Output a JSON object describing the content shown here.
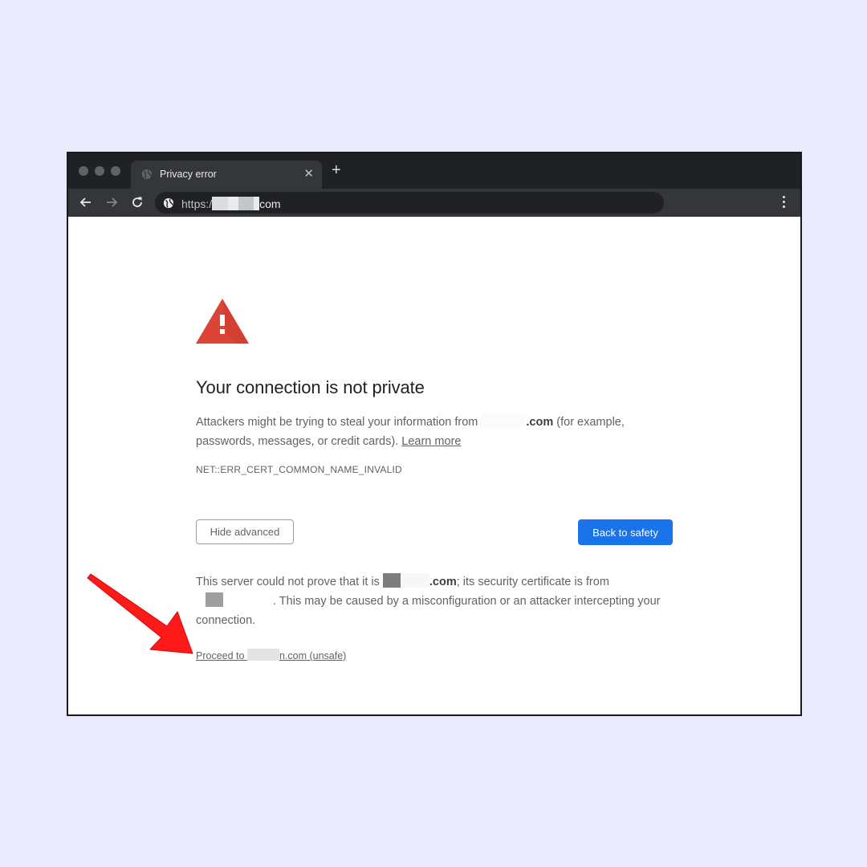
{
  "browser": {
    "tab": {
      "title": "Privacy error",
      "close_icon": "close-icon",
      "favicon": "globe-icon"
    },
    "new_tab_label": "+",
    "address_bar": {
      "scheme": "https:/",
      "host_suffix": "com",
      "redacted": true,
      "icon": "globe-icon"
    },
    "nav_icons": [
      "back-arrow-icon",
      "forward-arrow-icon",
      "reload-icon"
    ],
    "menu_icon": "kebab-menu-icon"
  },
  "page": {
    "warning_icon": "warning-triangle-icon",
    "heading": "Your connection is not private",
    "paragraph1": {
      "before": "Attackers might be trying to steal your information from ",
      "domain_suffix": ".com",
      "after": " (for example, passwords, messages, or credit cards). ",
      "learn_more": "Learn more"
    },
    "error_code": "NET::ERR_CERT_COMMON_NAME_INVALID",
    "buttons": {
      "hide_advanced": "Hide advanced",
      "back_to_safety": "Back to safety"
    },
    "paragraph3": {
      "before": "This server could not prove that it is ",
      "domain_suffix": ".com",
      "middle": "; its security certificate is from ",
      "after": ". This may be caused by a misconfiguration or an attacker intercepting your connection."
    },
    "proceed_link": {
      "before": "Proceed to ",
      "after": "n.com (unsafe)"
    }
  },
  "annotation": {
    "arrow_color": "#ff1a1a",
    "points_to": "proceed-link"
  },
  "colors": {
    "background": "#e9ebfc",
    "accent_blue": "#1a73e8",
    "warning_red": "#db4437",
    "chrome_dark": "#202124",
    "toolbar_dark": "#35363a"
  }
}
